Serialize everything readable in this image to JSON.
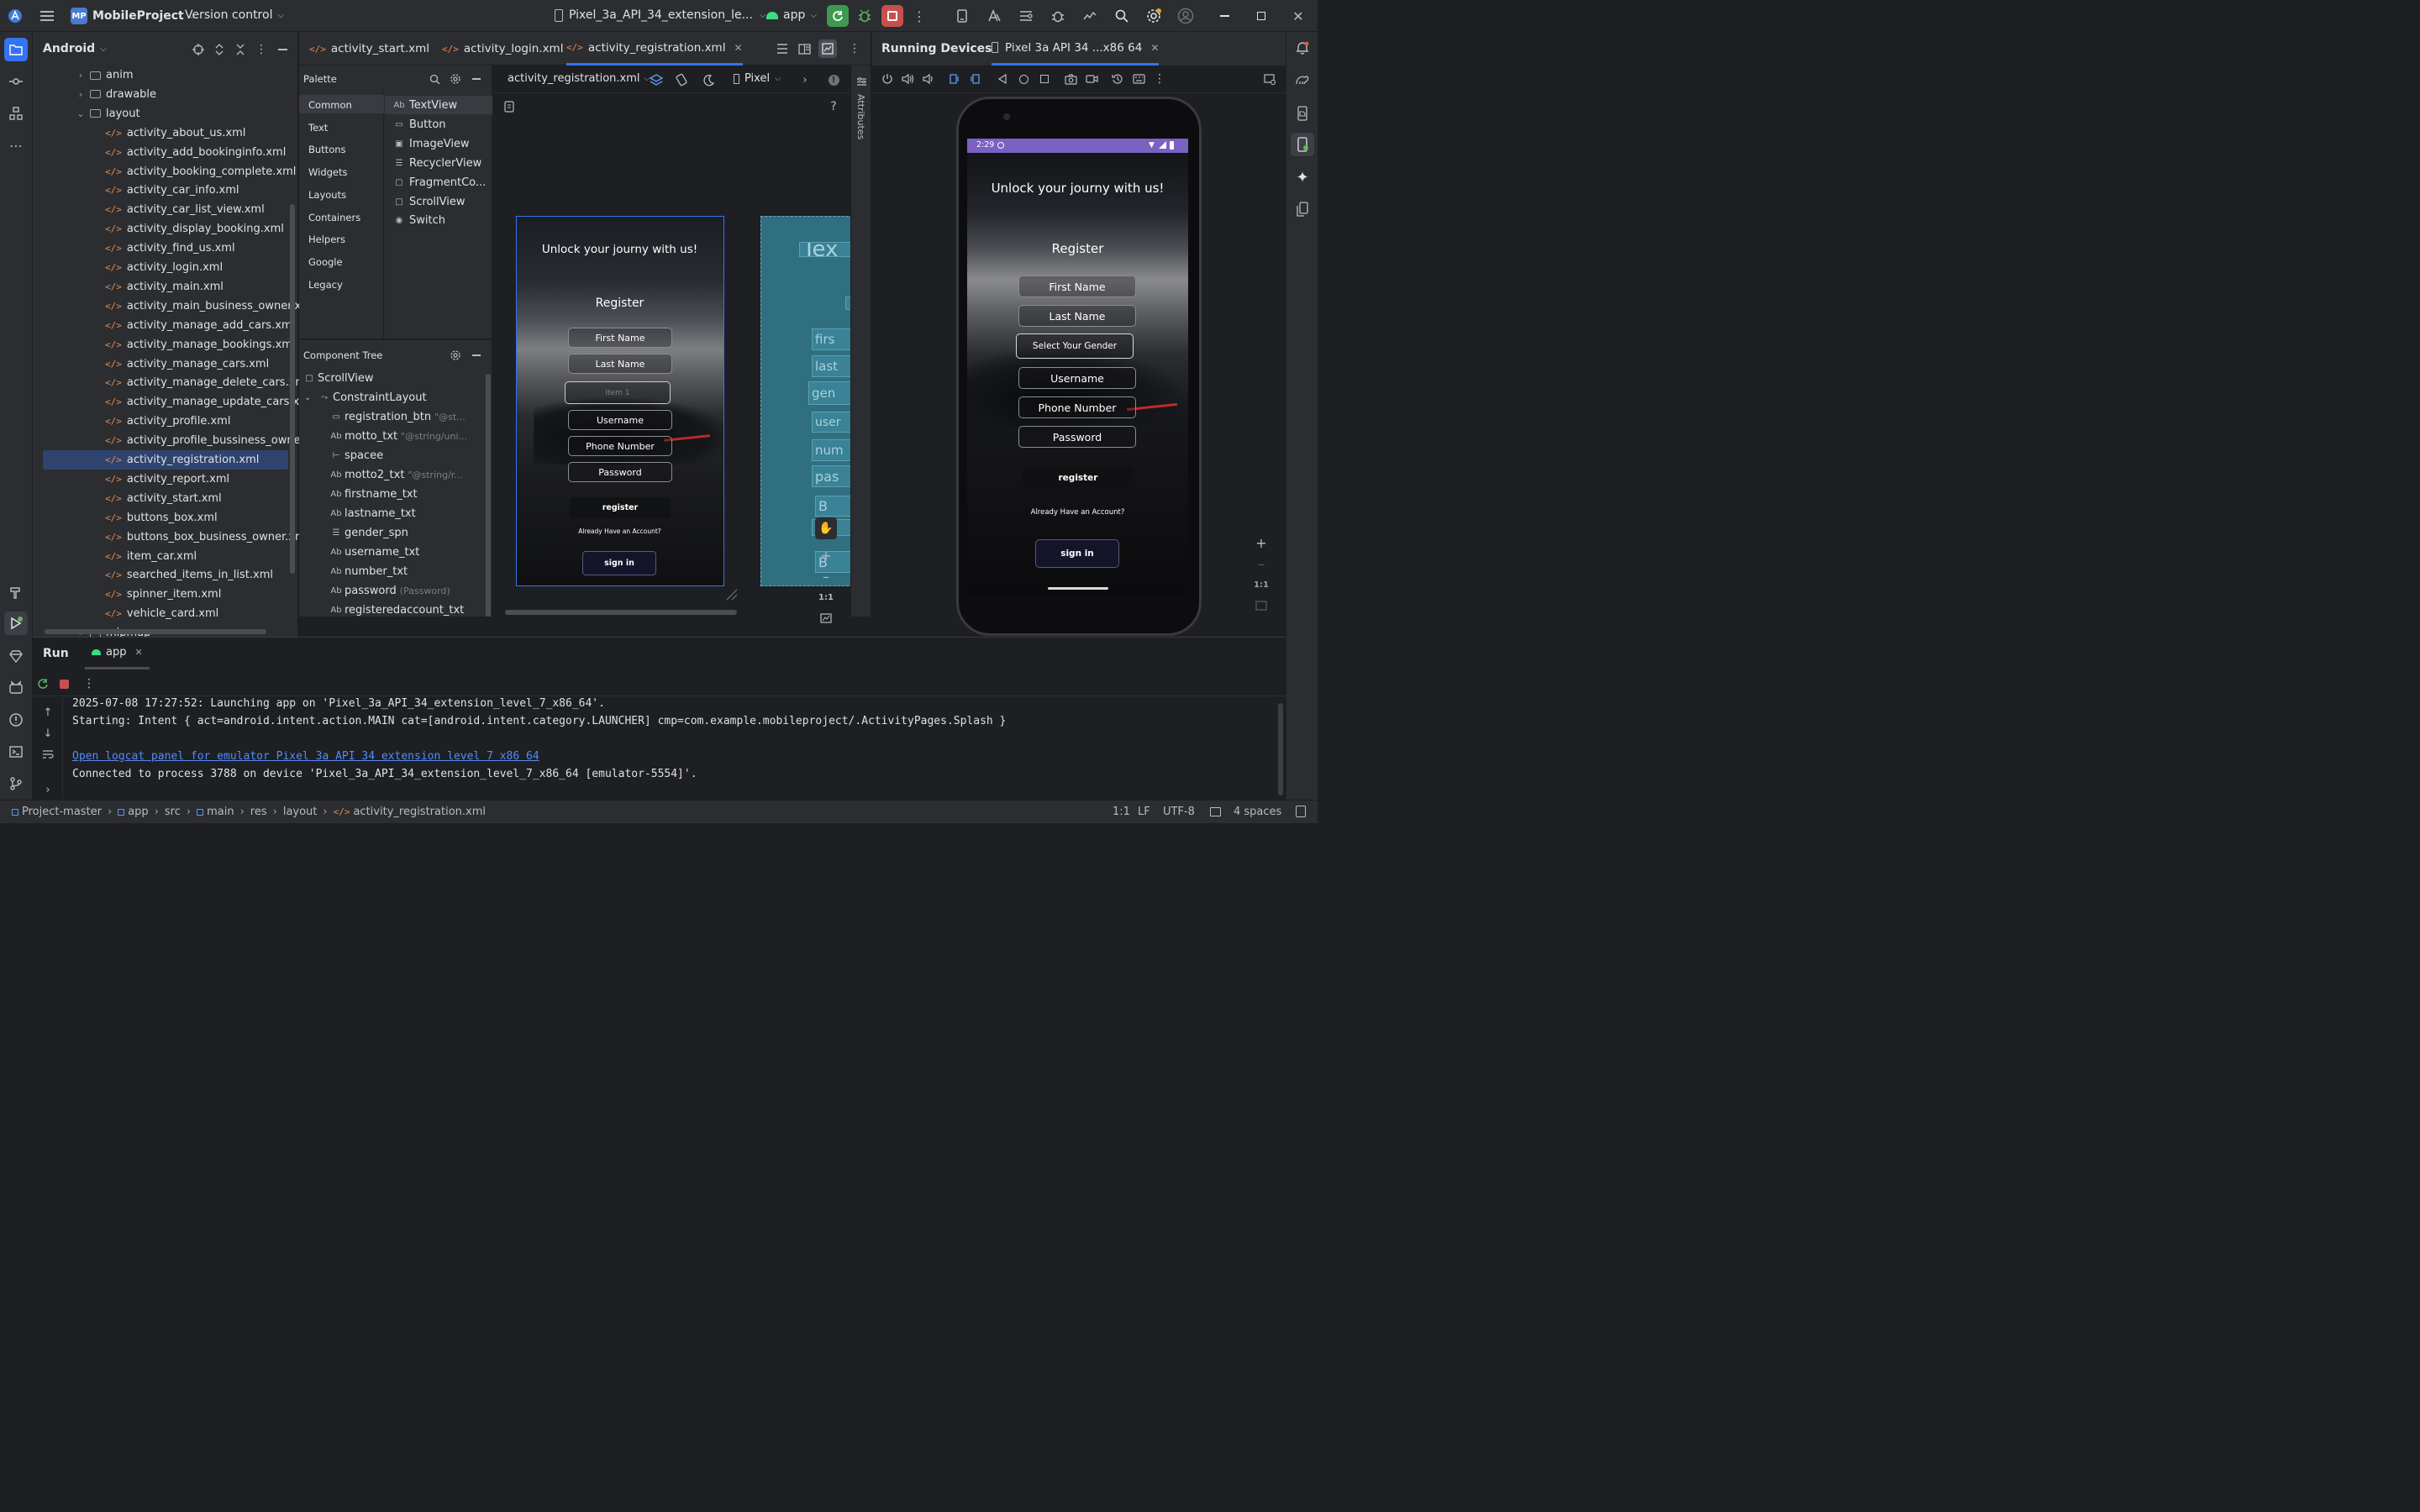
{
  "topbar": {
    "project_badge": "MP",
    "project_name": "MobileProject",
    "vcs": "Version control",
    "device": "Pixel_3a_API_34_extension_le...",
    "run_config": "app"
  },
  "project_panel": {
    "view_mode": "Android",
    "items": [
      {
        "label": "anim",
        "type": "folder"
      },
      {
        "label": "drawable",
        "type": "folder"
      },
      {
        "label": "layout",
        "type": "folder-open"
      },
      {
        "label": "activity_about_us.xml",
        "type": "xml"
      },
      {
        "label": "activity_add_bookinginfo.xml",
        "type": "xml"
      },
      {
        "label": "activity_booking_complete.xml",
        "type": "xml"
      },
      {
        "label": "activity_car_info.xml",
        "type": "xml"
      },
      {
        "label": "activity_car_list_view.xml",
        "type": "xml"
      },
      {
        "label": "activity_display_booking.xml",
        "type": "xml"
      },
      {
        "label": "activity_find_us.xml",
        "type": "xml"
      },
      {
        "label": "activity_login.xml",
        "type": "xml"
      },
      {
        "label": "activity_main.xml",
        "type": "xml"
      },
      {
        "label": "activity_main_business_owner.xml",
        "type": "xml"
      },
      {
        "label": "activity_manage_add_cars.xml",
        "type": "xml"
      },
      {
        "label": "activity_manage_bookings.xml",
        "type": "xml"
      },
      {
        "label": "activity_manage_cars.xml",
        "type": "xml"
      },
      {
        "label": "activity_manage_delete_cars.xml",
        "type": "xml"
      },
      {
        "label": "activity_manage_update_cars.xml",
        "type": "xml"
      },
      {
        "label": "activity_profile.xml",
        "type": "xml"
      },
      {
        "label": "activity_profile_bussiness_owner.xml",
        "type": "xml"
      },
      {
        "label": "activity_registration.xml",
        "type": "xml-selected"
      },
      {
        "label": "activity_report.xml",
        "type": "xml"
      },
      {
        "label": "activity_start.xml",
        "type": "xml"
      },
      {
        "label": "buttons_box.xml",
        "type": "xml"
      },
      {
        "label": "buttons_box_business_owner.xml",
        "type": "xml"
      },
      {
        "label": "item_car.xml",
        "type": "xml"
      },
      {
        "label": "searched_items_in_list.xml",
        "type": "xml"
      },
      {
        "label": "spinner_item.xml",
        "type": "xml"
      },
      {
        "label": "vehicle_card.xml",
        "type": "xml"
      },
      {
        "label": "mipmap",
        "type": "folder"
      }
    ]
  },
  "editor_tabs": [
    {
      "label": "activity_start.xml"
    },
    {
      "label": "activity_login.xml"
    },
    {
      "label": "activity_registration.xml"
    }
  ],
  "palette": {
    "title": "Palette",
    "categories": [
      "Common",
      "Text",
      "Buttons",
      "Widgets",
      "Layouts",
      "Containers",
      "Helpers",
      "Google",
      "Legacy"
    ],
    "items": [
      {
        "label": "TextView",
        "icon": "Ab"
      },
      {
        "label": "Button",
        "icon": "button-icon"
      },
      {
        "label": "ImageView",
        "icon": "image-icon"
      },
      {
        "label": "RecyclerView",
        "icon": "list-icon"
      },
      {
        "label": "FragmentCo...",
        "icon": "fragment-icon"
      },
      {
        "label": "ScrollView",
        "icon": "scroll-icon"
      },
      {
        "label": "Switch",
        "icon": "switch-icon"
      }
    ]
  },
  "component_tree": {
    "title": "Component Tree",
    "rows": [
      {
        "label": "ScrollView",
        "hint": "",
        "icon": "scroll"
      },
      {
        "label": "ConstraintLayout",
        "hint": "",
        "icon": "constraint"
      },
      {
        "label": "registration_btn",
        "hint": "\"@st...",
        "icon": "button"
      },
      {
        "label": "motto_txt",
        "hint": "\"@string/uni...",
        "icon": "Ab"
      },
      {
        "label": "spacee",
        "hint": "",
        "icon": "space"
      },
      {
        "label": "motto2_txt",
        "hint": "\"@string/r...",
        "icon": "Ab"
      },
      {
        "label": "firstname_txt",
        "hint": "",
        "icon": "Ab-edit"
      },
      {
        "label": "lastname_txt",
        "hint": "",
        "icon": "Ab-edit"
      },
      {
        "label": "gender_spn",
        "hint": "",
        "icon": "spinner"
      },
      {
        "label": "username_txt",
        "hint": "",
        "icon": "Ab-edit"
      },
      {
        "label": "number_txt",
        "hint": "",
        "icon": "Ab-edit"
      },
      {
        "label": "password",
        "hint": "(Password)",
        "icon": "Ab-edit"
      },
      {
        "label": "registeredaccount_txt",
        "hint": "",
        "icon": "Ab"
      }
    ]
  },
  "design_toolbar": {
    "file": "activity_registration.xml",
    "device": "Pixel",
    "attributes_label": "Attributes"
  },
  "design_preview": {
    "motto": "Unlock your journy with us!",
    "title": "Register",
    "fields": [
      "First Name",
      "Last Name",
      "Item 1",
      "Username",
      "Phone Number",
      "Password"
    ],
    "register_btn": "register",
    "already": "Already Have an Account?",
    "signin_btn": "sign in",
    "zoom_fit": "1:1"
  },
  "blueprint": {
    "labels": [
      "Tex",
      "",
      "firs",
      "last",
      "gen",
      "user",
      "num",
      "pas",
      "B",
      "re",
      "B"
    ]
  },
  "running_devices": {
    "title": "Running Devices",
    "tab": "Pixel 3a API 34 ...x86 64",
    "zoom_fit": "1:1",
    "phone": {
      "time": "2:29",
      "motto": "Unlock your journy with us!",
      "title": "Register",
      "fields": [
        "First Name",
        "Last Name",
        "Select Your Gender",
        "Username",
        "Phone Number",
        "Password"
      ],
      "register_btn": "register",
      "already": "Already Have an Account?",
      "signin_btn": "sign in"
    }
  },
  "run_panel": {
    "tab_run": "Run",
    "tab_app": "app",
    "lines": [
      "2025-07-08 17:27:52: Launching app on 'Pixel_3a_API_34_extension_level_7_x86_64'.",
      "Starting: Intent { act=android.intent.action.MAIN cat=[android.intent.category.LAUNCHER] cmp=com.example.mobileproject/.ActivityPages.Splash }",
      "",
      "Open logcat panel for emulator Pixel 3a API 34 extension level 7 x86 64",
      "Connected to process 3788 on device 'Pixel_3a_API_34_extension_level_7_x86_64 [emulator-5554]'."
    ]
  },
  "status_bar": {
    "breadcrumbs": [
      "Project-master",
      "app",
      "src",
      "main",
      "res",
      "layout",
      "activity_registration.xml"
    ],
    "position": "1:1",
    "line_sep": "LF",
    "encoding": "UTF-8",
    "indent": "4 spaces"
  },
  "colors": {
    "accent": "#3574f0",
    "phone_statusbar": "#7b61c2",
    "run_green": "#3d9a50",
    "stop_red": "#c94f4f",
    "xml_icon": "#e38b53"
  }
}
